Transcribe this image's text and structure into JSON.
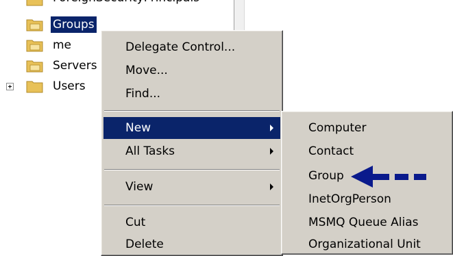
{
  "tree": {
    "top_partial_label": "ForeignSecurityPrincipals",
    "items": [
      {
        "label": "Groups",
        "selected": true,
        "expandable": false
      },
      {
        "label": "me",
        "selected": false,
        "expandable": false
      },
      {
        "label": "Servers",
        "selected": false,
        "expandable": false
      },
      {
        "label": "Users",
        "selected": false,
        "expandable": true
      }
    ]
  },
  "context_menu": {
    "items": [
      {
        "label": "Delegate Control...",
        "has_submenu": false
      },
      {
        "label": "Move...",
        "has_submenu": false
      },
      {
        "label": "Find...",
        "has_submenu": false
      },
      {
        "label": "New",
        "has_submenu": true,
        "highlighted": true
      },
      {
        "label": "All Tasks",
        "has_submenu": true
      },
      {
        "label": "View",
        "has_submenu": true
      },
      {
        "label": "Cut",
        "has_submenu": false
      },
      {
        "label": "Delete",
        "has_submenu": false
      }
    ]
  },
  "new_submenu": {
    "items": [
      {
        "label": "Computer"
      },
      {
        "label": "Contact"
      },
      {
        "label": "Group"
      },
      {
        "label": "InetOrgPerson"
      },
      {
        "label": "MSMQ Queue Alias"
      },
      {
        "label": "Organizational Unit"
      }
    ]
  },
  "annotation": {
    "arrow_color": "#0a1a8c",
    "points_to": "Group"
  },
  "colors": {
    "highlight": "#0a246a",
    "menu_background": "#d4d0c8",
    "folder_yellow": "#e8c158"
  }
}
